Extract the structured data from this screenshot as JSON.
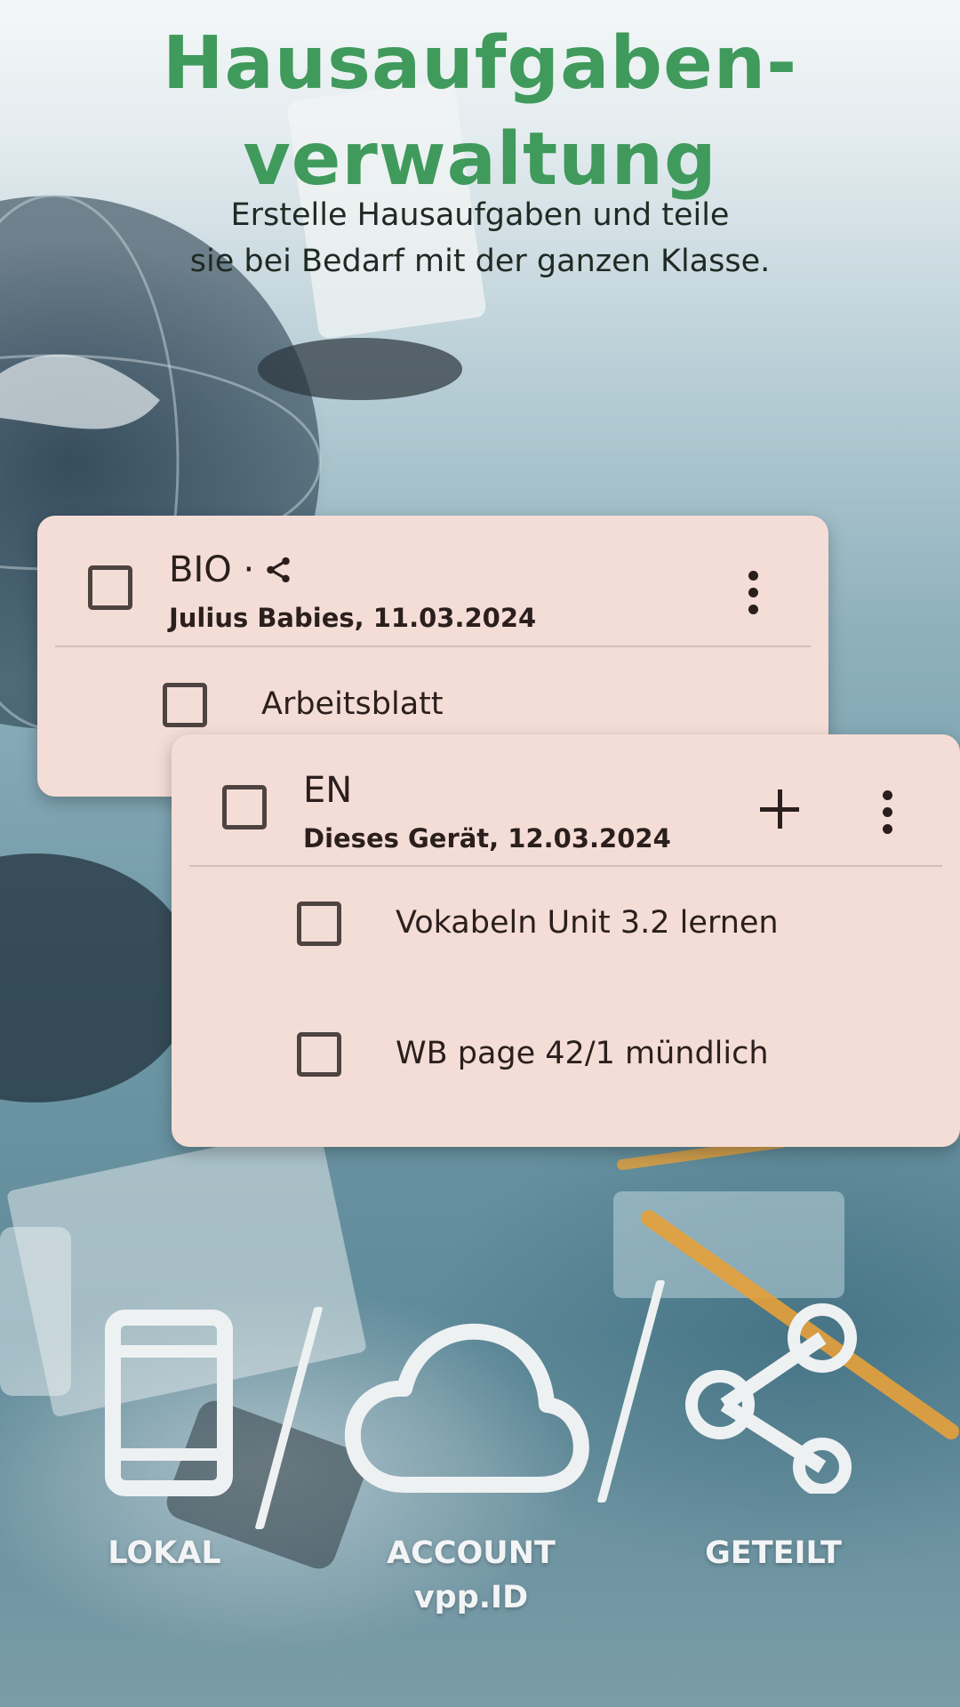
{
  "header": {
    "title_line1": "Hausaufgaben-",
    "title_line2": "verwaltung",
    "subtitle_line1": "Erstelle Hausaufgaben und teile",
    "subtitle_line2": "sie bei Bedarf mit der ganzen Klasse."
  },
  "cards": [
    {
      "subject": "BIO ·",
      "meta": "Julius Babies, 11.03.2024",
      "shared": true,
      "tasks": [
        "Arbeitsblatt"
      ]
    },
    {
      "subject": "EN",
      "meta": "Dieses Gerät, 12.03.2024",
      "shared": false,
      "tasks": [
        "Vokabeln Unit 3.2 lernen",
        "WB page 42/1 mündlich"
      ]
    }
  ],
  "modes": {
    "local": "LOKAL",
    "account_line1": "ACCOUNT",
    "account_line2": "vpp.ID",
    "shared": "GETEILT"
  },
  "colors": {
    "title_green": "#3f9a5c",
    "card_background": "#f4ddd6",
    "icon_white": "#eef1f2"
  },
  "icons": [
    "share-icon",
    "more-vert-icon",
    "plus-icon",
    "phone-icon",
    "cloud-icon",
    "share-icon"
  ]
}
